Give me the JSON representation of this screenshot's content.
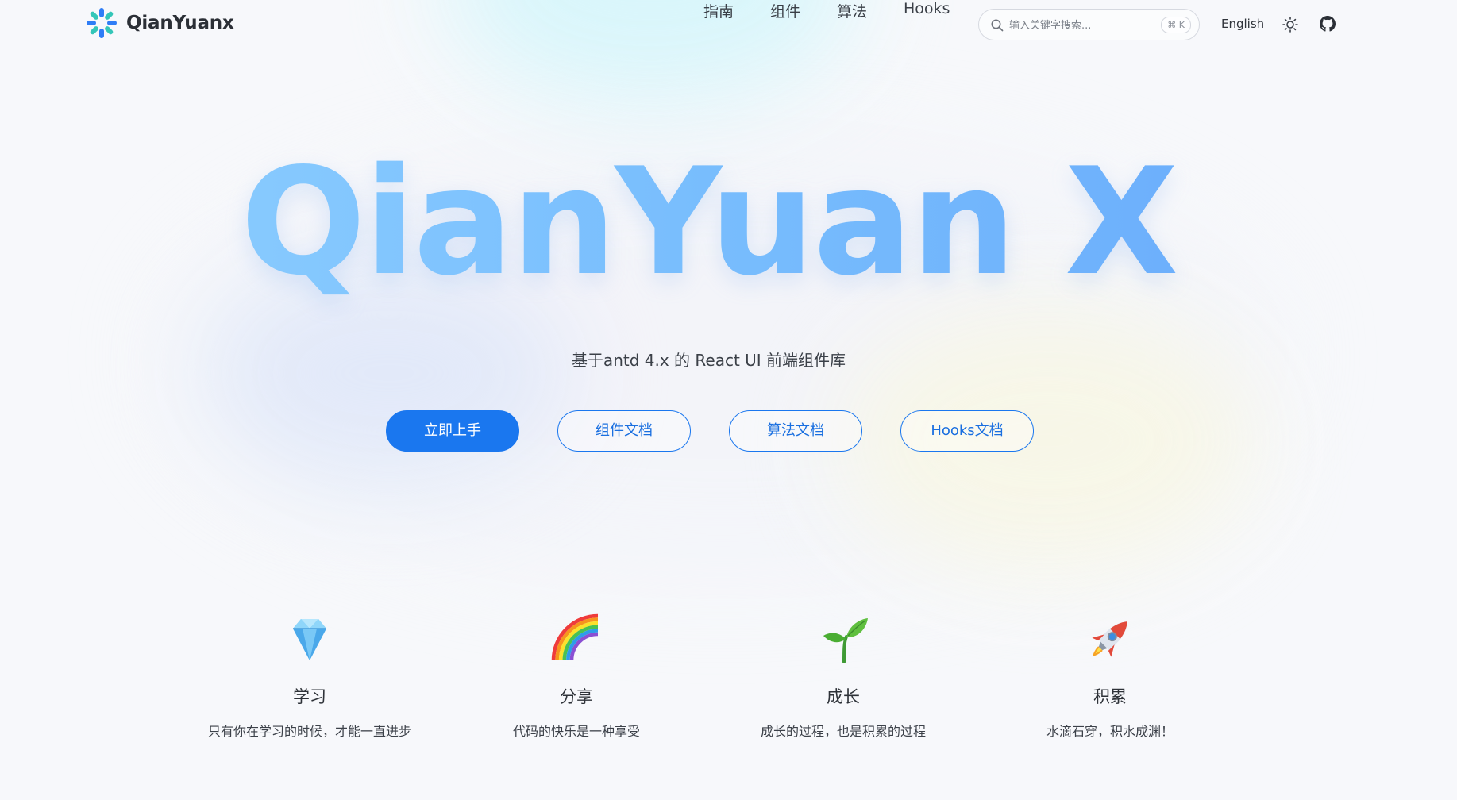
{
  "header": {
    "logo_text": "QianYuanx",
    "nav": [
      "指南",
      "组件",
      "算法",
      "Hooks"
    ],
    "search": {
      "placeholder": "输入关键字搜索...",
      "shortcut": "⌘ K"
    },
    "language": "English",
    "icons": [
      "search-icon",
      "theme-icon",
      "github-icon"
    ]
  },
  "hero": {
    "title": "QianYuan X",
    "subtitle": "基于antd 4.x 的 React UI 前端组件库",
    "buttons": [
      {
        "label": "立即上手",
        "style": "primary"
      },
      {
        "label": "组件文档",
        "style": "outline"
      },
      {
        "label": "算法文档",
        "style": "outline"
      },
      {
        "label": "Hooks文档",
        "style": "outline"
      }
    ]
  },
  "features": [
    {
      "icon": "gem-icon",
      "title": "学习",
      "desc": "只有你在学习的时候，才能一直进步"
    },
    {
      "icon": "rainbow-icon",
      "title": "分享",
      "desc": "代码的快乐是一种享受"
    },
    {
      "icon": "seedling-icon",
      "title": "成长",
      "desc": "成长的过程，也是积累的过程"
    },
    {
      "icon": "rocket-icon",
      "title": "积累",
      "desc": "水滴石穿，积水成渊！"
    }
  ],
  "colors": {
    "primary": "#1a77ef",
    "title_gradient_start": "#8ed0ff",
    "title_gradient_end": "#67a9fb",
    "background": "#f7f8fb"
  }
}
